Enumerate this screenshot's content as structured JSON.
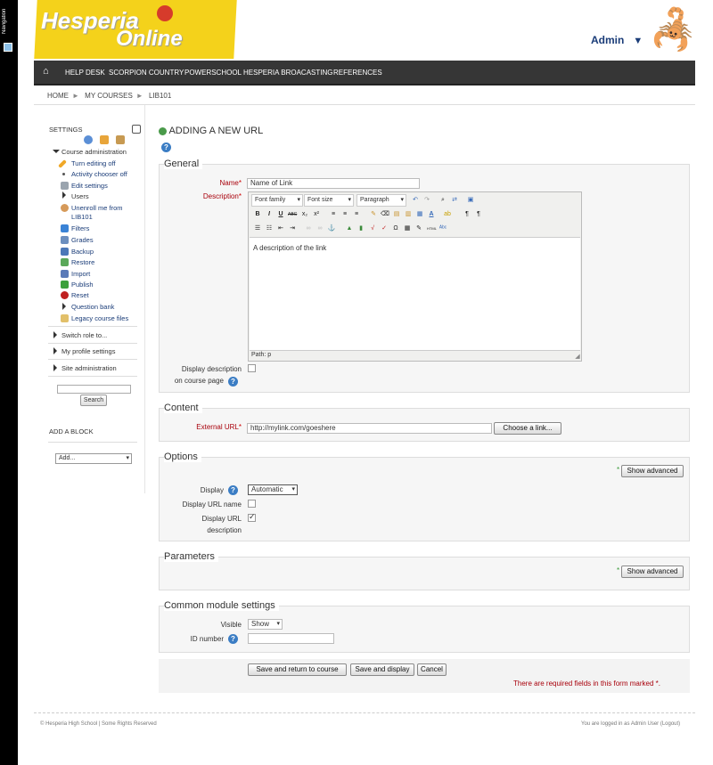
{
  "dock": {
    "label": "Navigation"
  },
  "logo": {
    "line1": "Hesperia",
    "line2": "Online"
  },
  "user": {
    "name": "Admin"
  },
  "nav": {
    "home_icon": "home-icon",
    "items": [
      "HELP DESK",
      "SCORPION COUNTRY",
      "POWERSCHOOL",
      "HESPERIA BROACASTING",
      "REFERENCES"
    ]
  },
  "breadcrumb": [
    "HOME",
    "MY COURSES",
    "LIB101"
  ],
  "sidebar": {
    "settings_title": "SETTINGS",
    "course_admin": "Course administration",
    "items": [
      {
        "label": "Turn editing off",
        "icon": "pencil-icon"
      },
      {
        "label": "Activity chooser off",
        "icon": "bullet"
      },
      {
        "label": "Edit settings",
        "icon": "settings-icon"
      },
      {
        "label": "Users",
        "icon": "arrow"
      },
      {
        "label": "Unenroll me from",
        "label2": "LIB101",
        "icon": "user-icon"
      },
      {
        "label": "Filters",
        "icon": "filter-icon"
      },
      {
        "label": "Grades",
        "icon": "grades-icon"
      },
      {
        "label": "Backup",
        "icon": "backup-icon"
      },
      {
        "label": "Restore",
        "icon": "restore-icon"
      },
      {
        "label": "Import",
        "icon": "import-icon"
      },
      {
        "label": "Publish",
        "icon": "publish-icon"
      },
      {
        "label": "Reset",
        "icon": "reset-icon"
      },
      {
        "label": "Question bank",
        "icon": "arrow"
      },
      {
        "label": "Legacy course files",
        "icon": "folder-icon"
      }
    ],
    "switch_role": "Switch role to...",
    "my_profile": "My profile settings",
    "site_admin": "Site administration",
    "search_button": "Search",
    "add_block_title": "ADD A BLOCK",
    "add_block_select": "Add..."
  },
  "page": {
    "title": "ADDING A NEW URL"
  },
  "general": {
    "legend": "General",
    "name_label": "Name",
    "name_value": "Name of Link",
    "description_label": "Description",
    "editor": {
      "font_family": "Font family",
      "font_size": "Font size",
      "paragraph": "Paragraph",
      "content": "A description of the link",
      "path": "Path: p"
    },
    "display_desc_label1": "Display description",
    "display_desc_label2": "on course page"
  },
  "content": {
    "legend": "Content",
    "url_label": "External URL",
    "url_value": "http://mylink.com/goeshere",
    "choose_link": "Choose a link..."
  },
  "options": {
    "legend": "Options",
    "show_advanced": "Show advanced",
    "display_label": "Display",
    "display_value": "Automatic",
    "display_name_label": "Display URL name",
    "display_desc_label1": "Display URL",
    "display_desc_label2": "description"
  },
  "parameters": {
    "legend": "Parameters",
    "show_advanced": "Show advanced"
  },
  "common": {
    "legend": "Common module settings",
    "visible_label": "Visible",
    "visible_value": "Show",
    "id_label": "ID number"
  },
  "actions": {
    "save_return": "Save and return to course",
    "save_display": "Save and display",
    "cancel": "Cancel",
    "required_note": "There are required fields in this form marked",
    "required_star": "*"
  },
  "footer": {
    "left": "© Hesperia High School | Some Rights Reserved",
    "right": "You are logged in as Admin User (Logout)"
  }
}
